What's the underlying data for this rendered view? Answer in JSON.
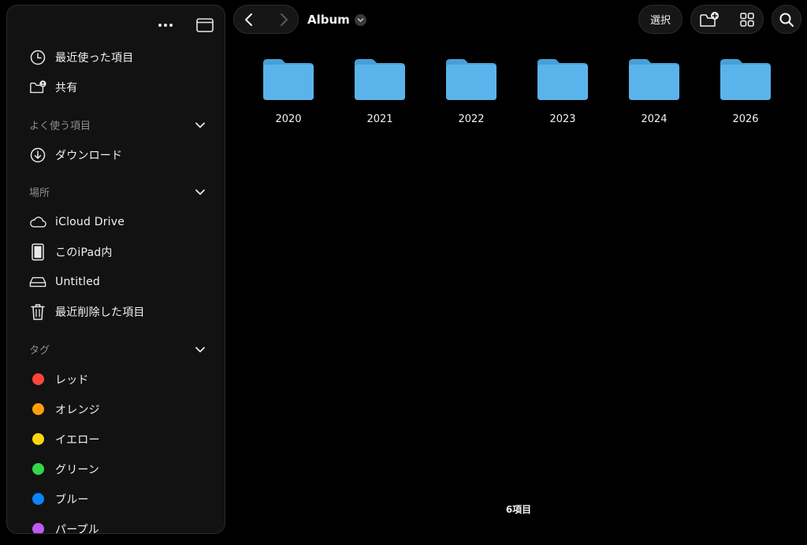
{
  "sidebar": {
    "items": {
      "recents": "最近使った項目",
      "shared": "共有"
    },
    "favorites": {
      "heading": "よく使う項目",
      "downloads": "ダウンロード"
    },
    "locations": {
      "heading": "場所",
      "icloud": "iCloud Drive",
      "ipad": "このiPad内",
      "untitled": "Untitled",
      "recently_deleted": "最近削除した項目"
    },
    "tags": {
      "heading": "タグ",
      "list": [
        {
          "label": "レッド",
          "color": "#ff453a"
        },
        {
          "label": "オレンジ",
          "color": "#ff9f0a"
        },
        {
          "label": "イエロー",
          "color": "#ffd60a"
        },
        {
          "label": "グリーン",
          "color": "#32d74b"
        },
        {
          "label": "ブルー",
          "color": "#0a84ff"
        },
        {
          "label": "パープル",
          "color": "#bf5af2"
        }
      ]
    }
  },
  "toolbar": {
    "title": "Album",
    "select_label": "選択"
  },
  "folders": [
    "2020",
    "2021",
    "2022",
    "2023",
    "2024",
    "2026"
  ],
  "footer": {
    "count": "6項目"
  },
  "colors": {
    "folder": "#5ab4eb",
    "folder_tab": "#46a0d7"
  }
}
